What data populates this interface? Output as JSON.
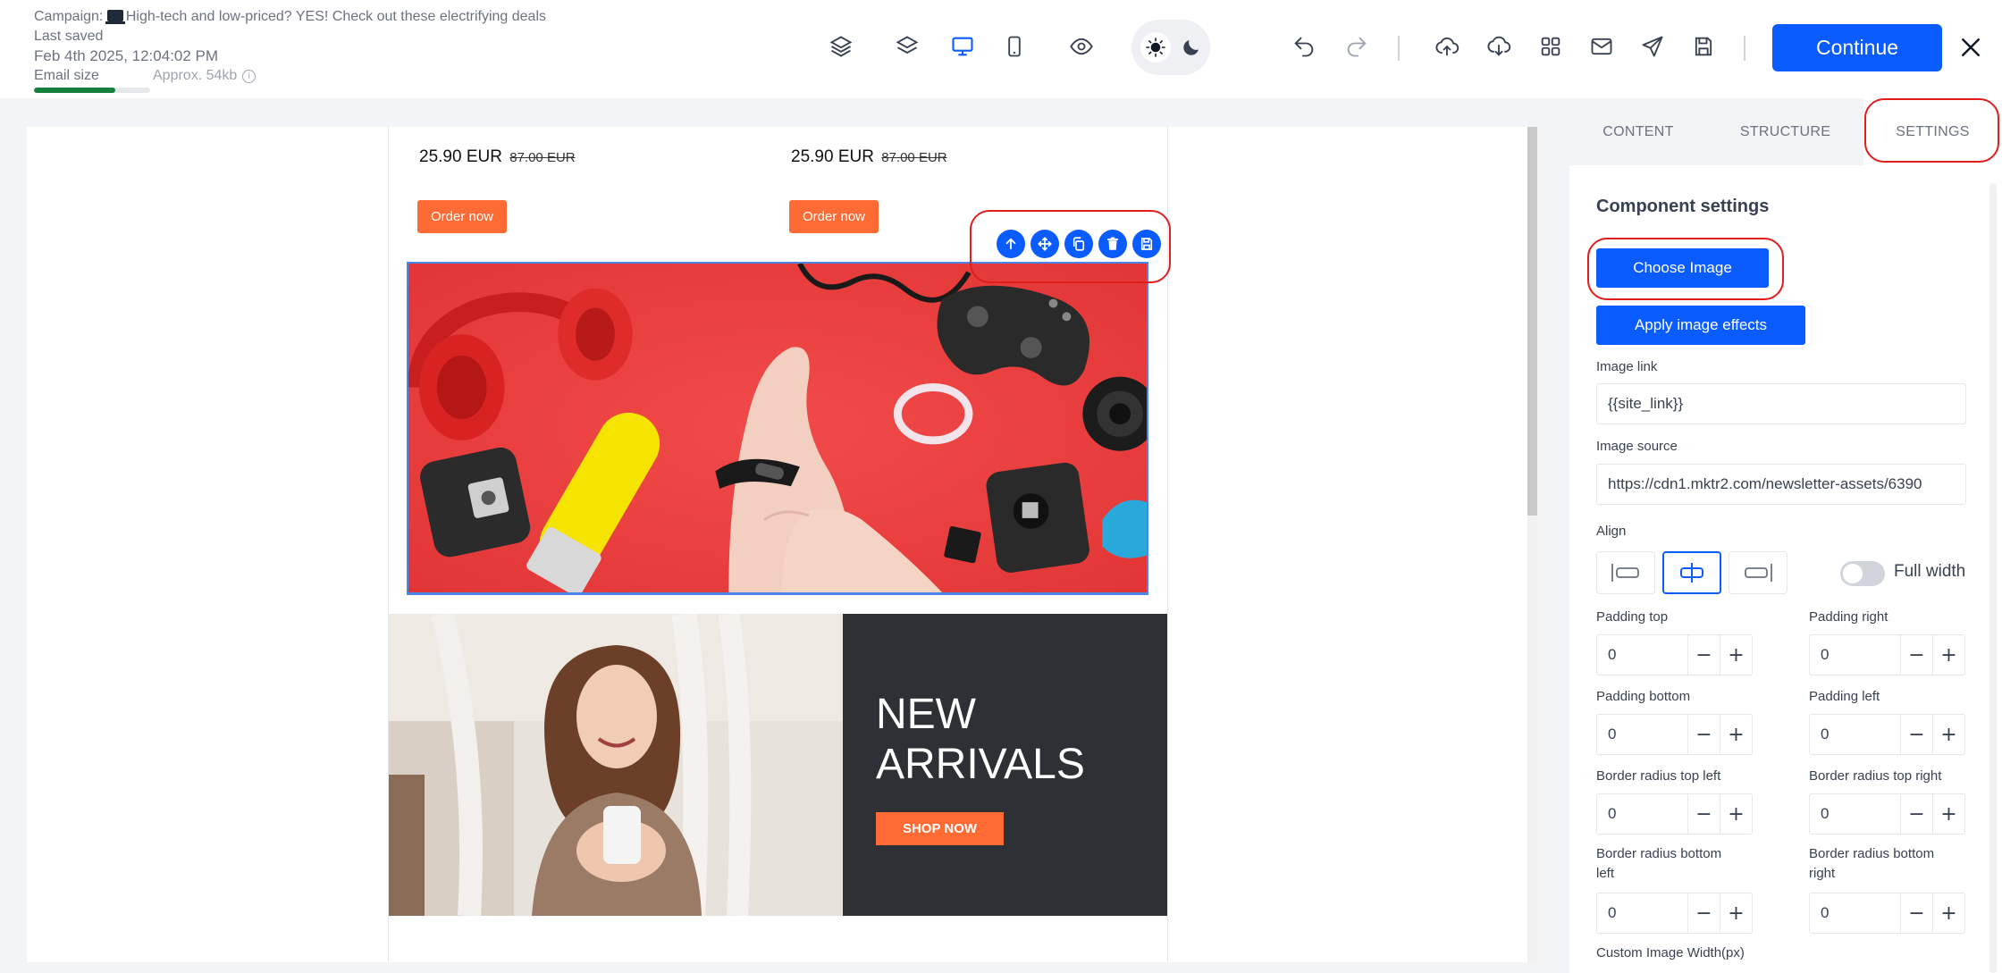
{
  "header": {
    "campaign_label": "Campaign: ",
    "campaign_name": "High-tech and low-priced? YES! Check out these electrifying deals",
    "last_saved_label": "Last saved",
    "saved_date": "Feb 4th 2025, 12:04:02 PM",
    "email_size_label": "Email size",
    "email_size_approx": "Approx. 54kb",
    "email_size_fill_fraction": 0.7,
    "continue_label": "Continue",
    "toolbar_icons": [
      "layers-stack-icon",
      "layers-icon",
      "desktop-icon",
      "mobile-icon",
      "preview-eye-icon",
      "sun-icon",
      "moon-icon",
      "undo-icon",
      "redo-icon",
      "upload-icon",
      "download-icon",
      "grid-icon",
      "mail-icon",
      "send-icon",
      "save-icon",
      "close-icon"
    ]
  },
  "email": {
    "products": [
      {
        "price": "25.90 EUR",
        "old_price": "87.00 EUR",
        "button": "Order now"
      },
      {
        "price": "25.90 EUR",
        "old_price": "87.00 EUR",
        "button": "Order now"
      }
    ],
    "block_tools": [
      "move-up-icon",
      "drag-icon",
      "duplicate-icon",
      "delete-icon",
      "save-block-icon"
    ],
    "banner": {
      "title_line1": "NEW",
      "title_line2": "ARRIVALS",
      "button": "SHOP NOW"
    }
  },
  "panel": {
    "tabs": [
      {
        "label": "CONTENT",
        "active": false
      },
      {
        "label": "STRUCTURE",
        "active": false
      },
      {
        "label": "SETTINGS",
        "active": true
      }
    ],
    "section_title": "Component settings",
    "choose_image": "Choose Image",
    "apply_effects": "Apply image effects",
    "image_link_label": "Image link",
    "image_link_value": "{{site_link}}",
    "image_source_label": "Image source",
    "image_source_value": "https://cdn1.mktr2.com/newsletter-assets/6390",
    "align_label": "Align",
    "align_selected": "center",
    "full_width_label": "Full width",
    "full_width_on": false,
    "fields": {
      "padding_top": {
        "label": "Padding top",
        "value": "0"
      },
      "padding_right": {
        "label": "Padding right",
        "value": "0"
      },
      "padding_bottom": {
        "label": "Padding bottom",
        "value": "0"
      },
      "padding_left": {
        "label": "Padding left",
        "value": "0"
      },
      "br_top_left": {
        "label": "Border radius top left",
        "value": "0"
      },
      "br_top_right": {
        "label": "Border radius top right",
        "value": "0"
      },
      "br_bottom_left_l1": "Border radius bottom",
      "br_bottom_left_l2": "left",
      "br_bottom_left_value": "0",
      "br_bottom_right_l1": "Border radius bottom",
      "br_bottom_right_l2": "right",
      "br_bottom_right_value": "0",
      "custom_width_label": "Custom Image Width(px)"
    },
    "stepper_minus": "−",
    "stepper_plus": "+"
  },
  "colors": {
    "primary": "#0b5cff",
    "accent_orange": "#ff6b35",
    "highlight_red": "#e11d1d",
    "size_bar_green": "#15803d"
  }
}
